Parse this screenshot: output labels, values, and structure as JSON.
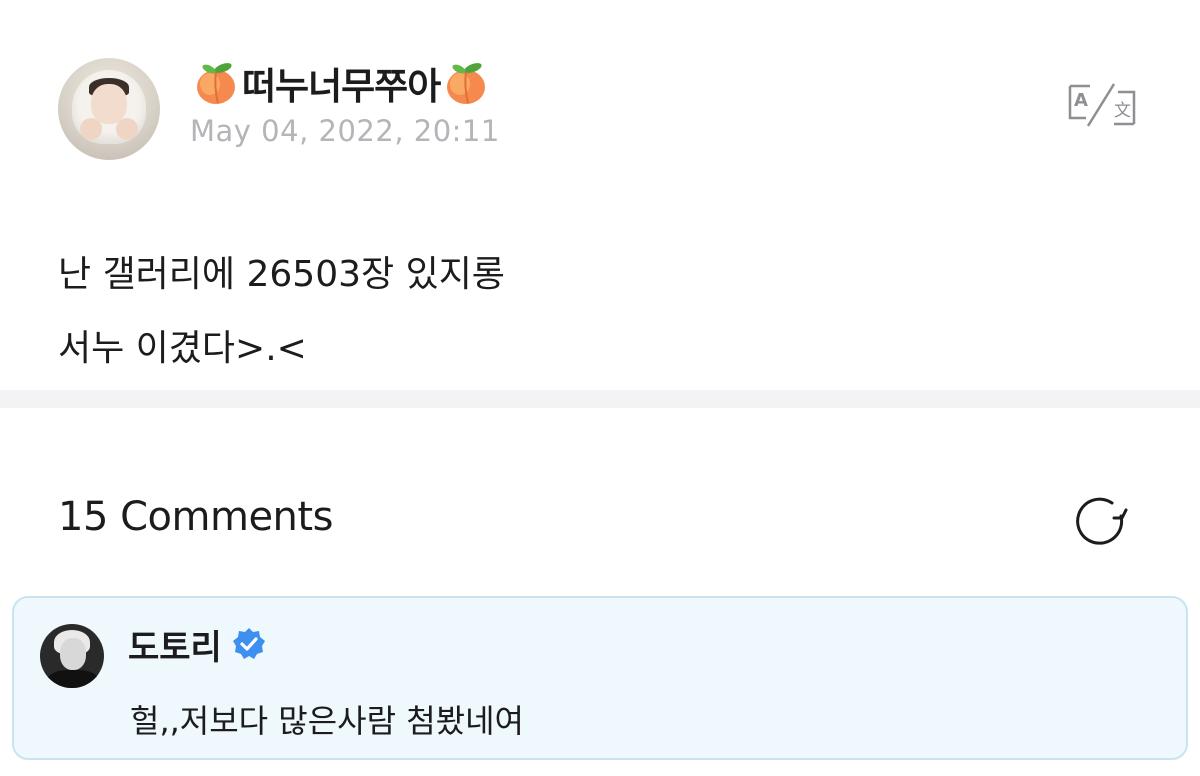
{
  "post": {
    "username": "떠누너무쭈아",
    "timestamp": "May 04, 2022, 20:11",
    "body_line1": "난 갤러리에 26503장 있지롱",
    "body_line2": "서누 이겼다>.<"
  },
  "comments": {
    "title": "15 Comments",
    "items": [
      {
        "username": "도토리",
        "verified": true,
        "text": "헐,,저보다 많은사람 첨봤네여"
      }
    ]
  },
  "icons": {
    "translate": "translate-icon",
    "refresh": "refresh-icon",
    "verified": "verified-badge-icon",
    "peach": "peach-emoji"
  },
  "colors": {
    "timestamp": "#b4b4b9",
    "verified": "#3d8ff0",
    "comment_card_bg": "#eef8fd",
    "comment_card_border": "#c9e4f1",
    "divider": "#f3f3f5"
  }
}
